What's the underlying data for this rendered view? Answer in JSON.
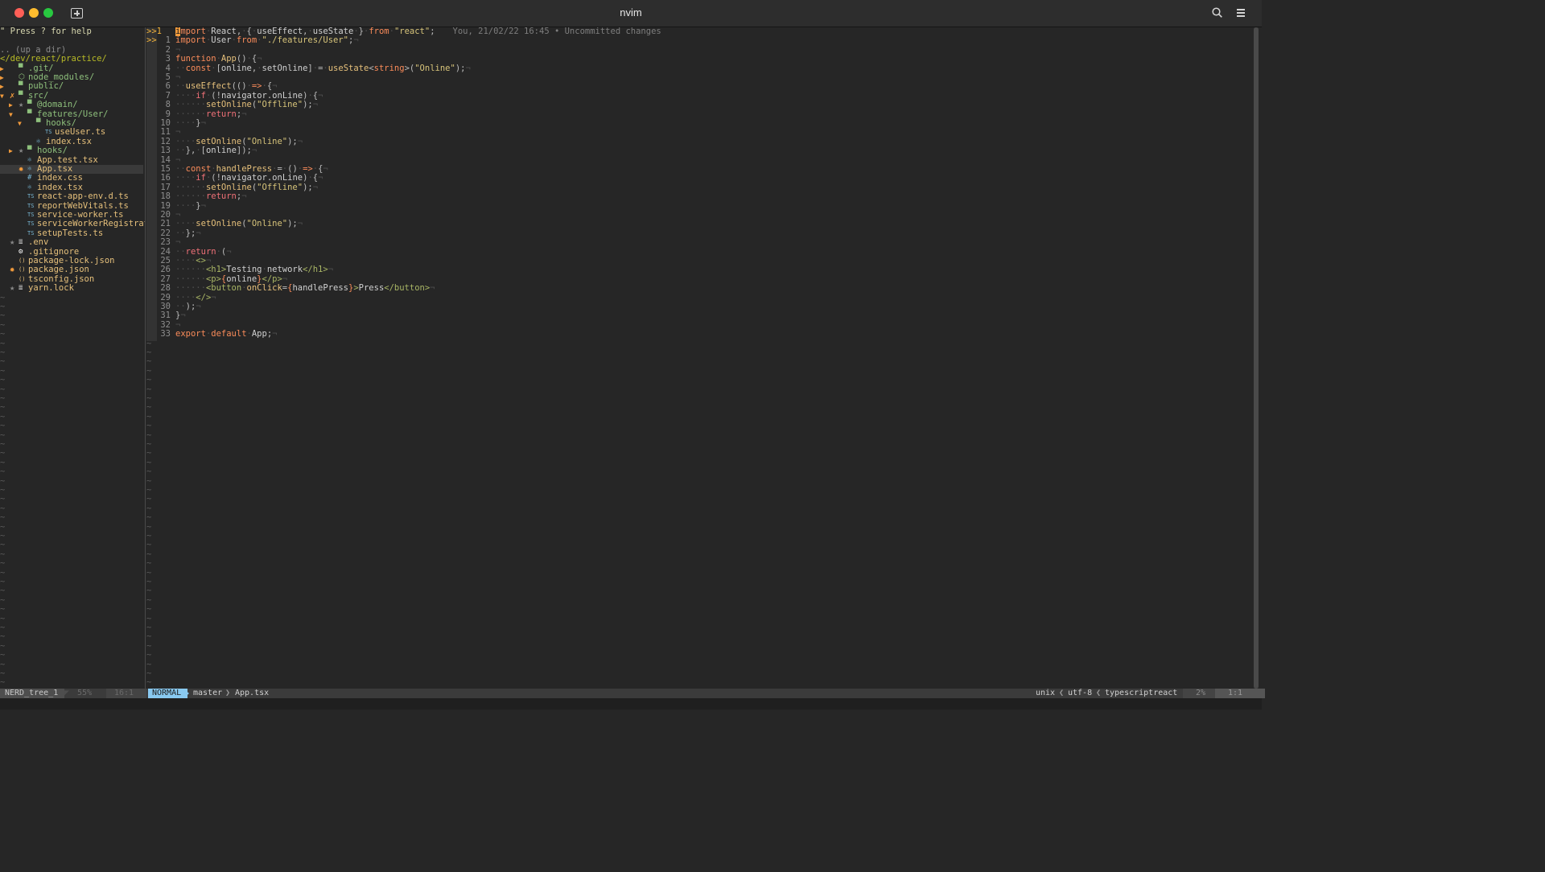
{
  "window": {
    "title": "nvim"
  },
  "tree": {
    "rows": [
      {
        "icon": "",
        "text": "\" Press ? for help",
        "color": "#d7d7af",
        "arrow": "",
        "git": ""
      },
      {
        "icon": "",
        "text": "",
        "color": "#d0d0d0",
        "arrow": "",
        "git": ""
      },
      {
        "icon": "",
        "text": ".. (up a dir)",
        "color": "#8a8a8a",
        "arrow": "",
        "git": ""
      },
      {
        "icon": "",
        "text": "</dev/react/practice/",
        "color": "#b8bb26",
        "arrow": "",
        "git": ""
      },
      {
        "icon": "folder",
        "text": ".git/",
        "color": "#8ec07c",
        "arrow": "▶",
        "git": ""
      },
      {
        "icon": "node",
        "text": "node_modules/",
        "color": "#8ec07c",
        "arrow": "▶",
        "git": ""
      },
      {
        "icon": "folder",
        "text": "public/",
        "color": "#8ec07c",
        "arrow": "▶",
        "git": ""
      },
      {
        "icon": "folder",
        "text": "src/",
        "color": "#8ec07c",
        "arrow": "▼",
        "git": "✗"
      },
      {
        "icon": "folder",
        "text": "@domain/",
        "color": "#8ec07c",
        "arrow": "▶",
        "git": "★",
        "indent": 1
      },
      {
        "icon": "folder",
        "text": "features/User/",
        "color": "#8ec07c",
        "arrow": "▼",
        "git": "",
        "indent": 1
      },
      {
        "icon": "folder",
        "text": "hooks/",
        "color": "#8ec07c",
        "arrow": "▼",
        "git": "",
        "indent": 2
      },
      {
        "icon": "ts",
        "text": "useUser.ts",
        "color": "#e6c07b",
        "arrow": "",
        "git": "",
        "indent": 3
      },
      {
        "icon": "react",
        "text": "index.tsx",
        "color": "#e6c07b",
        "arrow": "",
        "git": "",
        "indent": 2
      },
      {
        "icon": "folder",
        "text": "hooks/",
        "color": "#8ec07c",
        "arrow": "▶",
        "git": "★",
        "indent": 1
      },
      {
        "icon": "react",
        "text": "App.test.tsx",
        "color": "#e6c07b",
        "arrow": "",
        "git": "",
        "indent": 1
      },
      {
        "icon": "react",
        "text": "App.tsx",
        "color": "#e6c07b",
        "arrow": "",
        "git": "✹",
        "indent": 1,
        "selected": true
      },
      {
        "icon": "css",
        "text": "index.css",
        "color": "#e6c07b",
        "arrow": "",
        "git": "",
        "indent": 1
      },
      {
        "icon": "react",
        "text": "index.tsx",
        "color": "#e6c07b",
        "arrow": "",
        "git": "",
        "indent": 1
      },
      {
        "icon": "ts",
        "text": "react-app-env.d.ts",
        "color": "#e6c07b",
        "arrow": "",
        "git": "",
        "indent": 1
      },
      {
        "icon": "ts",
        "text": "reportWebVitals.ts",
        "color": "#e6c07b",
        "arrow": "",
        "git": "",
        "indent": 1
      },
      {
        "icon": "ts",
        "text": "service-worker.ts",
        "color": "#e6c07b",
        "arrow": "",
        "git": "",
        "indent": 1
      },
      {
        "icon": "ts",
        "text": "serviceWorkerRegistrati",
        "color": "#e6c07b",
        "arrow": "",
        "git": "",
        "indent": 1
      },
      {
        "icon": "ts",
        "text": "setupTests.ts",
        "color": "#e6c07b",
        "arrow": "",
        "git": "",
        "indent": 1
      },
      {
        "icon": "lines",
        "text": ".env",
        "color": "#e6c07b",
        "arrow": "",
        "git": "★"
      },
      {
        "icon": "gear",
        "text": ".gitignore",
        "color": "#e6c07b",
        "arrow": "",
        "git": ""
      },
      {
        "icon": "json",
        "text": "package-lock.json",
        "color": "#e6c07b",
        "arrow": "",
        "git": ""
      },
      {
        "icon": "json",
        "text": "package.json",
        "color": "#e6c07b",
        "arrow": "",
        "git": "✹"
      },
      {
        "icon": "json",
        "text": "tsconfig.json",
        "color": "#e6c07b",
        "arrow": "",
        "git": ""
      },
      {
        "icon": "lines",
        "text": "yarn.lock",
        "color": "#e6c07b",
        "arrow": "",
        "git": "★"
      }
    ]
  },
  "editor": {
    "blame": "You, 21/02/22 16:45 • Uncommitted changes",
    "lines": [
      {
        "sign": ">>1",
        "num": "",
        "html": "<span class='yel'>i</span><span class='kw'>mport</span><span class='ws'>·</span><span class='id'>React</span><span class='pl'>,</span><span class='ws'>·</span><span class='pl'>{</span><span class='ws'>·</span><span class='id'>useEffect</span><span class='pl'>,</span><span class='ws'>·</span><span class='id'>useState</span><span class='ws'>·</span><span class='pl'>}</span><span class='ws'>·</span><span class='kw'>from</span><span class='ws'>·</span><span class='str'>\"react\"</span><span class='pl'>;</span>"
      },
      {
        "sign": ">>",
        "num": "1",
        "html": "<span class='kw'>import</span><span class='ws'>·</span><span class='id'>User</span><span class='ws'>·</span><span class='kw'>from</span><span class='ws'>·</span><span class='str'>\"./features/User\"</span><span class='pl'>;</span><span class='ws'>¬</span>"
      },
      {
        "sign": "",
        "num": "2",
        "html": "<span class='ws'>¬</span>"
      },
      {
        "sign": "",
        "num": "3",
        "html": "<span class='kw'>function</span><span class='ws'>·</span><span class='fn'>App</span><span class='pl'>()</span><span class='ws'>·</span><span class='pl'>{</span><span class='ws'>¬</span>"
      },
      {
        "sign": "",
        "num": "4",
        "html": "<span class='ws'>··</span><span class='kw'>const</span><span class='ws'>·</span><span class='pl'>[</span><span class='id'>online</span><span class='pl'>,</span><span class='ws'>·</span><span class='id'>setOnline</span><span class='pl'>]</span><span class='ws'>·</span><span class='pl'>=</span><span class='ws'>·</span><span class='fn'>useState</span><span class='pl'>&lt;</span><span class='kw'>string</span><span class='pl'>&gt;(</span><span class='str'>\"Online\"</span><span class='pl'>);</span><span class='ws'>¬</span>"
      },
      {
        "sign": "",
        "num": "5",
        "html": "<span class='ws'>¬</span>"
      },
      {
        "sign": "",
        "num": "6",
        "html": "<span class='ws'>··</span><span class='fn'>useEffect</span><span class='pl'>(()</span><span class='ws'>·</span><span class='kw'>=&gt;</span><span class='ws'>·</span><span class='pl'>{</span><span class='ws'>¬</span>"
      },
      {
        "sign": "",
        "num": "7",
        "html": "<span class='ws'>····</span><span class='kw2'>if</span><span class='ws'>·</span><span class='pl'>(!</span><span class='id'>navigator</span><span class='pl'>.</span><span class='id'>onLine</span><span class='pl'>)</span><span class='ws'>·</span><span class='pl'>{</span><span class='ws'>¬</span>"
      },
      {
        "sign": "",
        "num": "8",
        "html": "<span class='ws'>······</span><span class='fn'>setOnline</span><span class='pl'>(</span><span class='str'>\"Offline\"</span><span class='pl'>);</span><span class='ws'>¬</span>"
      },
      {
        "sign": "",
        "num": "9",
        "html": "<span class='ws'>······</span><span class='kw2'>return</span><span class='pl'>;</span><span class='ws'>¬</span>"
      },
      {
        "sign": "",
        "num": "10",
        "html": "<span class='ws'>····</span><span class='pl'>}</span><span class='ws'>¬</span>"
      },
      {
        "sign": "",
        "num": "11",
        "html": "<span class='ws'>¬</span>"
      },
      {
        "sign": "",
        "num": "12",
        "html": "<span class='ws'>····</span><span class='fn'>setOnline</span><span class='pl'>(</span><span class='str'>\"Online\"</span><span class='pl'>);</span><span class='ws'>¬</span>"
      },
      {
        "sign": "",
        "num": "13",
        "html": "<span class='ws'>··</span><span class='pl'>},</span><span class='ws'>·</span><span class='pl'>[</span><span class='id'>online</span><span class='pl'>]);</span><span class='ws'>¬</span>"
      },
      {
        "sign": "",
        "num": "14",
        "html": "<span class='ws'>¬</span>"
      },
      {
        "sign": "",
        "num": "15",
        "html": "<span class='ws'>··</span><span class='kw'>const</span><span class='ws'>·</span><span class='fn'>handlePress</span><span class='ws'>·</span><span class='pl'>=</span><span class='ws'>·</span><span class='pl'>()</span><span class='ws'>·</span><span class='kw'>=&gt;</span><span class='ws'>·</span><span class='pl'>{</span><span class='ws'>¬</span>"
      },
      {
        "sign": "",
        "num": "16",
        "html": "<span class='ws'>····</span><span class='kw2'>if</span><span class='ws'>·</span><span class='pl'>(!</span><span class='id'>navigator</span><span class='pl'>.</span><span class='id'>onLine</span><span class='pl'>)</span><span class='ws'>·</span><span class='pl'>{</span><span class='ws'>¬</span>"
      },
      {
        "sign": "",
        "num": "17",
        "html": "<span class='ws'>······</span><span class='fn'>setOnline</span><span class='pl'>(</span><span class='str'>\"Offline\"</span><span class='pl'>);</span><span class='ws'>¬</span>"
      },
      {
        "sign": "",
        "num": "18",
        "html": "<span class='ws'>······</span><span class='kw2'>return</span><span class='pl'>;</span><span class='ws'>¬</span>"
      },
      {
        "sign": "",
        "num": "19",
        "html": "<span class='ws'>····</span><span class='pl'>}</span><span class='ws'>¬</span>"
      },
      {
        "sign": "",
        "num": "20",
        "html": "<span class='ws'>¬</span>"
      },
      {
        "sign": "",
        "num": "21",
        "html": "<span class='ws'>····</span><span class='fn'>setOnline</span><span class='pl'>(</span><span class='str'>\"Online\"</span><span class='pl'>);</span><span class='ws'>¬</span>"
      },
      {
        "sign": "",
        "num": "22",
        "html": "<span class='ws'>··</span><span class='pl'>};</span><span class='ws'>¬</span>"
      },
      {
        "sign": "",
        "num": "23",
        "html": "<span class='ws'>¬</span>"
      },
      {
        "sign": "",
        "num": "24",
        "html": "<span class='ws'>··</span><span class='kw2'>return</span><span class='ws'>·</span><span class='pl'>(</span><span class='ws'>¬</span>"
      },
      {
        "sign": "",
        "num": "25",
        "html": "<span class='ws'>····</span><span class='tag'>&lt;&gt;</span><span class='ws'>¬</span>"
      },
      {
        "sign": "",
        "num": "26",
        "html": "<span class='ws'>······</span><span class='tag'>&lt;h1&gt;</span><span class='id'>Testing</span><span class='ws'>·</span><span class='id'>network</span><span class='tag'>&lt;/h1&gt;</span><span class='ws'>¬</span>"
      },
      {
        "sign": "",
        "num": "27",
        "html": "<span class='ws'>······</span><span class='tag'>&lt;p&gt;</span><span class='kw'>{</span><span class='id'>online</span><span class='kw'>}</span><span class='tag'>&lt;/p&gt;</span><span class='ws'>¬</span>"
      },
      {
        "sign": "",
        "num": "28",
        "html": "<span class='ws'>······</span><span class='tag'>&lt;button</span><span class='ws'>·</span><span class='fn'>onClick</span><span class='pl'>=</span><span class='kw'>{</span><span class='id'>handlePress</span><span class='kw'>}</span><span class='tag'>&gt;</span><span class='id'>Press</span><span class='tag'>&lt;/button&gt;</span><span class='ws'>¬</span>"
      },
      {
        "sign": "",
        "num": "29",
        "html": "<span class='ws'>····</span><span class='tag'>&lt;/&gt;</span><span class='ws'>¬</span>"
      },
      {
        "sign": "",
        "num": "30",
        "html": "<span class='ws'>··</span><span class='pl'>);</span><span class='ws'>¬</span>"
      },
      {
        "sign": "",
        "num": "31",
        "html": "<span class='pl'>}</span><span class='ws'>¬</span>"
      },
      {
        "sign": "",
        "num": "32",
        "html": "<span class='ws'>¬</span>"
      },
      {
        "sign": "",
        "num": "33",
        "html": "<span class='kw'>export</span><span class='ws'>·</span><span class='kw'>default</span><span class='ws'>·</span><span class='id'>App</span><span class='pl'>;</span><span class='ws'>¬</span>"
      }
    ]
  },
  "statusbar": {
    "tree_name": "NERD_tree_1",
    "tree_percent": "55%",
    "tree_pos": "16:1",
    "mode": "NORMAL",
    "branch": "master",
    "file": "App.tsx",
    "fileformat": "unix",
    "encoding": "utf-8",
    "filetype": "typescriptreact",
    "percent": "2%",
    "position": "1:1"
  },
  "colors": {
    "mode_bg": "#89c9f0",
    "accent_orange": "#f29b3c"
  }
}
